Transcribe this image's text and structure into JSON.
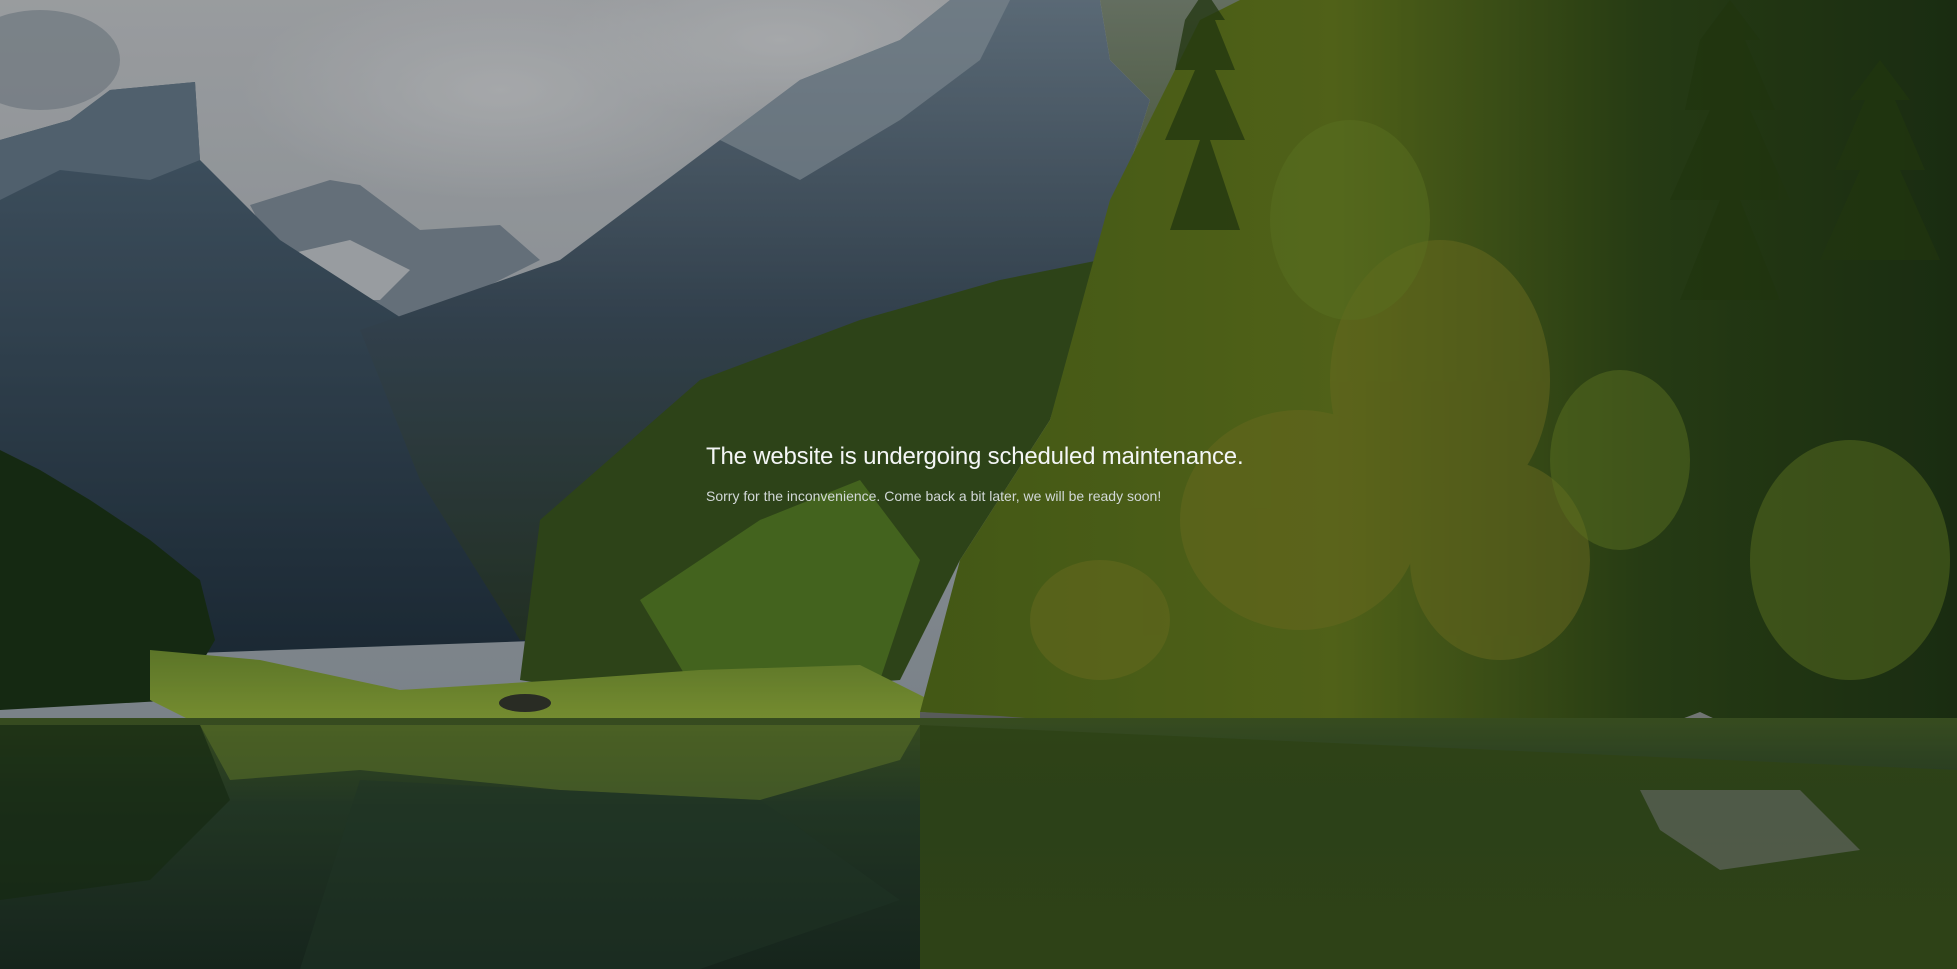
{
  "maintenance": {
    "headline": "The website is undergoing scheduled maintenance.",
    "message": "Sorry for the inconvenience. Come back a bit later, we will be ready soon!"
  },
  "background": {
    "scene": "mountain-lake-landscape",
    "colors": {
      "sky": "#c9cdd2",
      "mountain": "#3f5566",
      "forest": "#4a6a1c",
      "meadow": "#8fb13a",
      "lake": "#2f4a34"
    }
  }
}
